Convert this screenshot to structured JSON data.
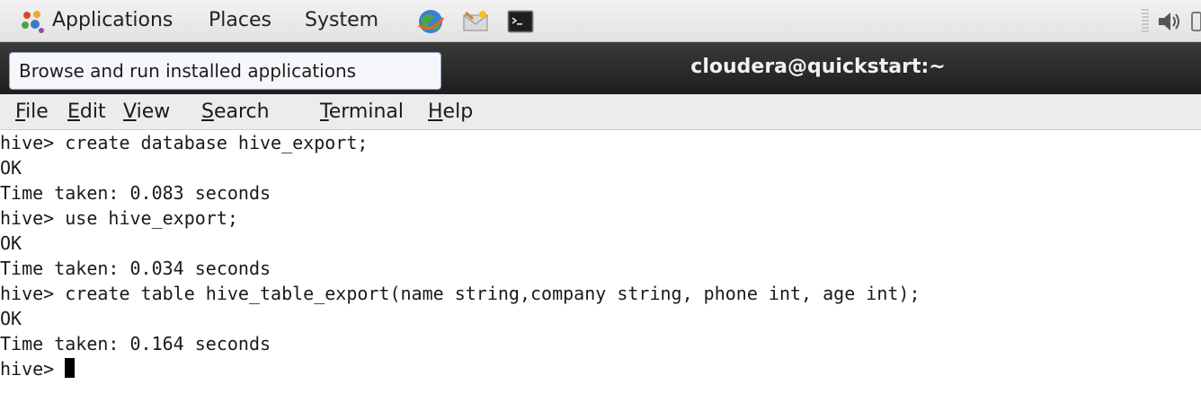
{
  "top_panel": {
    "menus": {
      "applications": "Applications",
      "places": "Places",
      "system": "System"
    },
    "launchers": [
      "web-browser-icon",
      "email-client-icon",
      "terminal-icon"
    ],
    "tray": [
      "volume-icon"
    ]
  },
  "tooltip": {
    "text": "Browse and run installed applications"
  },
  "window": {
    "title": "cloudera@quickstart:~"
  },
  "terminal_menu": {
    "file": "File",
    "edit": "Edit",
    "view": "View",
    "search": "Search",
    "terminal": "Terminal",
    "help": "Help"
  },
  "terminal": {
    "lines": [
      "hive> create database hive_export;",
      "OK",
      "Time taken: 0.083 seconds",
      "hive> use hive_export;",
      "OK",
      "Time taken: 0.034 seconds",
      "hive> create table hive_table_export(name string,company string, phone int, age int);",
      "OK",
      "Time taken: 0.164 seconds"
    ],
    "prompt": "hive> "
  },
  "colors": {
    "panel_bg": "#e8e8e8",
    "titlebar_bg": "#2b2b2b",
    "tooltip_border": "#8aa0c2",
    "terminal_bg": "#ffffff",
    "terminal_fg": "#1a1a1a"
  }
}
